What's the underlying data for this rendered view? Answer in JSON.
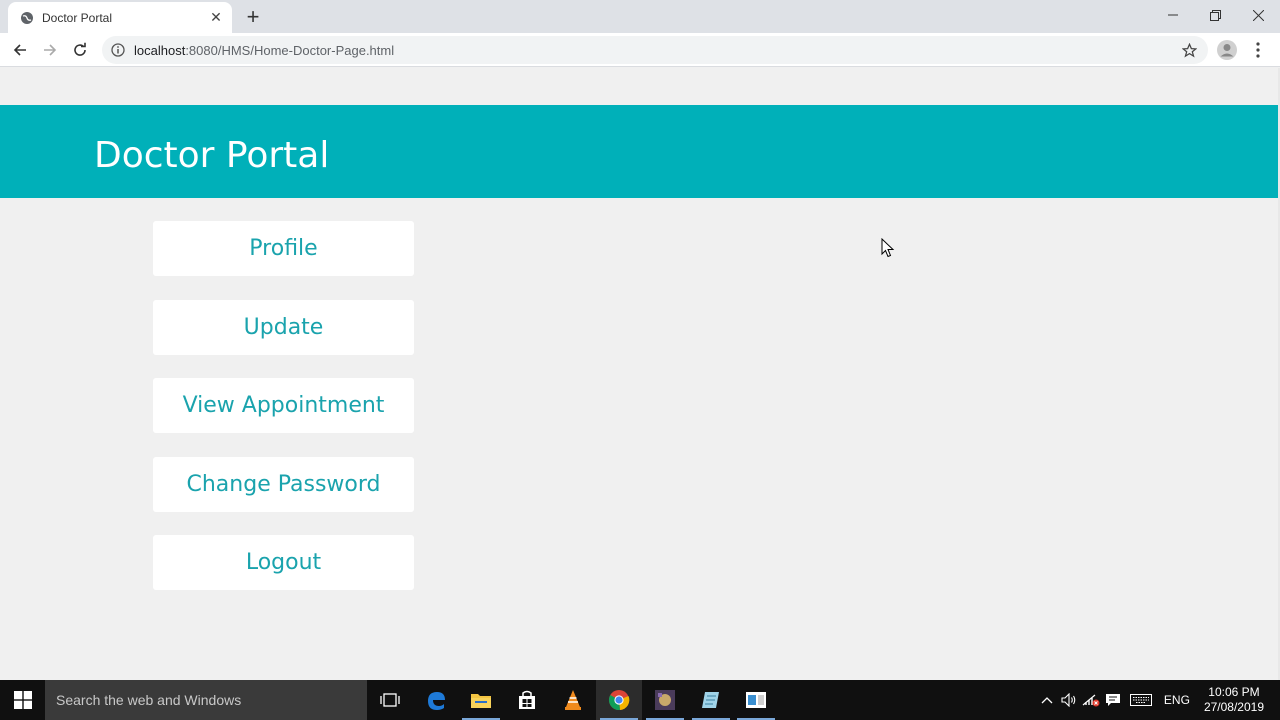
{
  "browser": {
    "tab_title": "Doctor Portal",
    "url_host": "localhost",
    "url_path": ":8080/HMS/Home-Doctor-Page.html"
  },
  "page": {
    "header_title": "Doctor Portal",
    "menu": [
      {
        "label": "Profile"
      },
      {
        "label": "Update"
      },
      {
        "label": "View Appointment"
      },
      {
        "label": "Change Password"
      },
      {
        "label": "Logout"
      }
    ],
    "colors": {
      "header_bg": "#00b0b9",
      "button_text": "#1aa3ad",
      "page_bg": "#f0f0f0"
    }
  },
  "taskbar": {
    "search_placeholder": "Search the web and Windows",
    "language": "ENG",
    "time": "10:06 PM",
    "date": "27/08/2019",
    "icons": [
      "task-view-icon",
      "edge-icon",
      "file-explorer-icon",
      "store-icon",
      "vlc-icon",
      "chrome-icon",
      "app-icon",
      "notepad-icon",
      "window-icon"
    ]
  }
}
